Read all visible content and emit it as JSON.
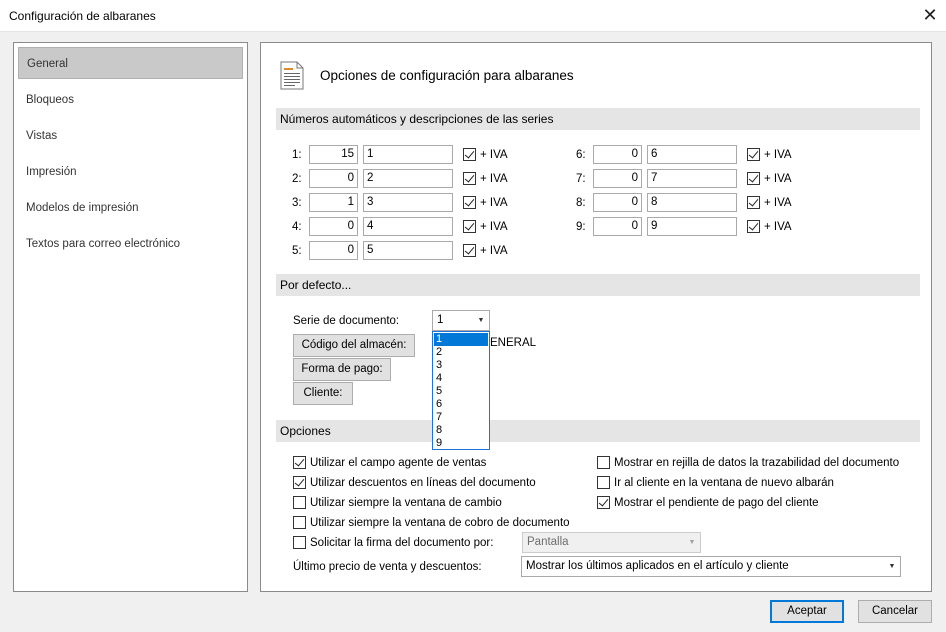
{
  "window": {
    "title": "Configuración de albaranes",
    "close_symbol": "✕"
  },
  "sidebar": {
    "items": [
      {
        "label": "General"
      },
      {
        "label": "Bloqueos"
      },
      {
        "label": "Vistas"
      },
      {
        "label": "Impresión"
      },
      {
        "label": "Modelos de impresión"
      },
      {
        "label": "Textos para correo electrónico"
      }
    ],
    "selected": "General"
  },
  "header": {
    "title": "Opciones de configuración para albaranes"
  },
  "series_section": {
    "title": "Números automáticos y descripciones de las series",
    "iva_label": "+ IVA",
    "rows": [
      {
        "label": "1:",
        "number": "15",
        "description": "1",
        "iva": true
      },
      {
        "label": "2:",
        "number": "0",
        "description": "2",
        "iva": true
      },
      {
        "label": "3:",
        "number": "1",
        "description": "3",
        "iva": true
      },
      {
        "label": "4:",
        "number": "0",
        "description": "4",
        "iva": true
      },
      {
        "label": "5:",
        "number": "0",
        "description": "5",
        "iva": true
      },
      {
        "label": "6:",
        "number": "0",
        "description": "6",
        "iva": true
      },
      {
        "label": "7:",
        "number": "0",
        "description": "7",
        "iva": true
      },
      {
        "label": "8:",
        "number": "0",
        "description": "8",
        "iva": true
      },
      {
        "label": "9:",
        "number": "0",
        "description": "9",
        "iva": true
      }
    ]
  },
  "defaults_section": {
    "title": "Por defecto...",
    "serie_label": "Serie de documento:",
    "serie_value": "1",
    "serie_options": [
      "1",
      "2",
      "3",
      "4",
      "5",
      "6",
      "7",
      "8",
      "9"
    ],
    "almacen_button": "Código del almacén:",
    "almacen_value_visible": "ENERAL",
    "forma_pago_button": "Forma de pago:",
    "cliente_button": "Cliente:"
  },
  "options_section": {
    "title": "Opciones",
    "checks_left": [
      {
        "label": "Utilizar el campo agente de ventas",
        "checked": true
      },
      {
        "label": "Utilizar descuentos en líneas del documento",
        "checked": true
      },
      {
        "label": "Utilizar siempre la ventana de cambio",
        "checked": false
      },
      {
        "label": "Utilizar siempre la ventana de cobro de documento",
        "checked": false
      },
      {
        "label": "Solicitar la firma del documento por:",
        "checked": false
      }
    ],
    "checks_right": [
      {
        "label": "Mostrar en rejilla de datos la trazabilidad del documento",
        "checked": false
      },
      {
        "label": "Ir al cliente en la ventana de nuevo albarán",
        "checked": false
      },
      {
        "label": "Mostrar el pendiente de pago del cliente",
        "checked": true
      }
    ],
    "firma_value": "Pantalla",
    "ultimo_precio_label": "Último precio de venta y descuentos:",
    "ultimo_precio_value": "Mostrar los últimos aplicados en el artículo y cliente"
  },
  "footer": {
    "accept": "Aceptar",
    "cancel": "Cancelar"
  },
  "icons": {
    "close": "close-icon",
    "document": "document-icon",
    "dropdown": "chevron-down-icon"
  },
  "colors": {
    "accent": "#0078d7",
    "section_bg": "#e5e5e5",
    "selected_item": "#c9c9c9"
  }
}
